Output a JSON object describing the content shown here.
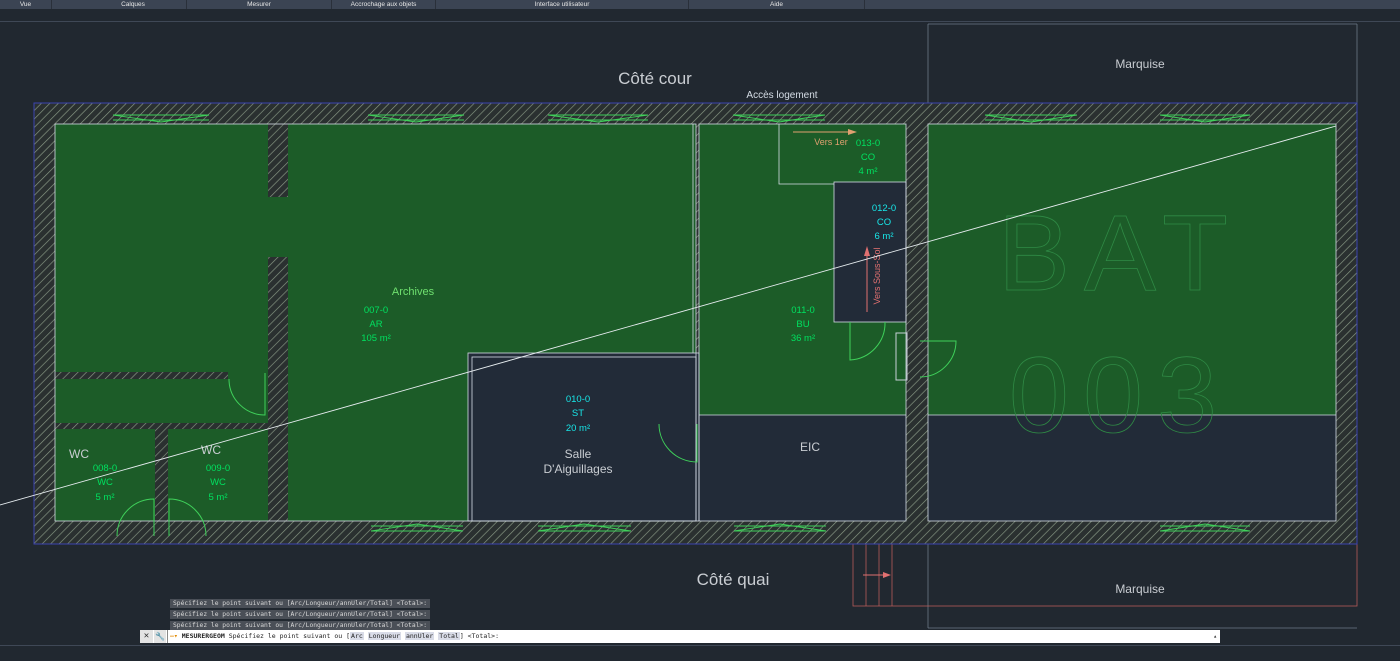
{
  "menu": {
    "items": [
      "Vue",
      "Calques",
      "Mesurer",
      "Accrochage aux objets",
      "Interface utilisateur",
      "Aide"
    ]
  },
  "drawing": {
    "top_label": "Côté cour",
    "bottom_label": "Côté quai",
    "marquise_top": "Marquise",
    "marquise_bottom": "Marquise",
    "acces_logement": "Accès logement",
    "vers_1er": "Vers 1er",
    "vers_sous_sol": "Vers Sous-Sol",
    "archives_label": "Archives",
    "salle_line1": "Salle",
    "salle_line2": "D'Aiguillages",
    "eic_label": "EIC",
    "wc_label_1": "WC",
    "wc_label_2": "WC",
    "bat_line1": "BAT",
    "bat_line2": "003",
    "rooms": [
      {
        "id": "007-0",
        "code": "AR",
        "area": "105 m²"
      },
      {
        "id": "010-0",
        "code": "ST",
        "area": "20 m²"
      },
      {
        "id": "011-0",
        "code": "BU",
        "area": "36 m²"
      },
      {
        "id": "012-0",
        "code": "CO",
        "area": "6 m²"
      },
      {
        "id": "013-0",
        "code": "CO",
        "area": "4 m²"
      },
      {
        "id": "008-0",
        "code": "WC",
        "area": "5 m²"
      },
      {
        "id": "009-0",
        "code": "WC",
        "area": "5 m²"
      }
    ]
  },
  "command": {
    "history": [
      "Spécifiez le point suivant ou [Arc/Longueur/annUler/Total] <Total>:",
      "Spécifiez le point suivant ou [Arc/Longueur/annUler/Total] <Total>:",
      "Spécifiez le point suivant ou [Arc/Longueur/annUler/Total] <Total>:"
    ],
    "command_name": "MESURERGEOM",
    "prompt_prefix": "Spécifiez le point suivant ou [",
    "options": [
      "Arc",
      "Longueur",
      "annUler",
      "Total"
    ],
    "prompt_suffix": "] <Total>:"
  },
  "colors": {
    "background": "#212830",
    "room_fill": "#1c5c28",
    "wall_hatch": "#5a6a54",
    "wall_edge": "#3c44b0",
    "room_text_cyan": "#18e6e8",
    "room_text_green": "#00e060",
    "label_grey": "#c9cdd2",
    "stair_orange": "#e0a070",
    "stair_red": "#e07070"
  }
}
